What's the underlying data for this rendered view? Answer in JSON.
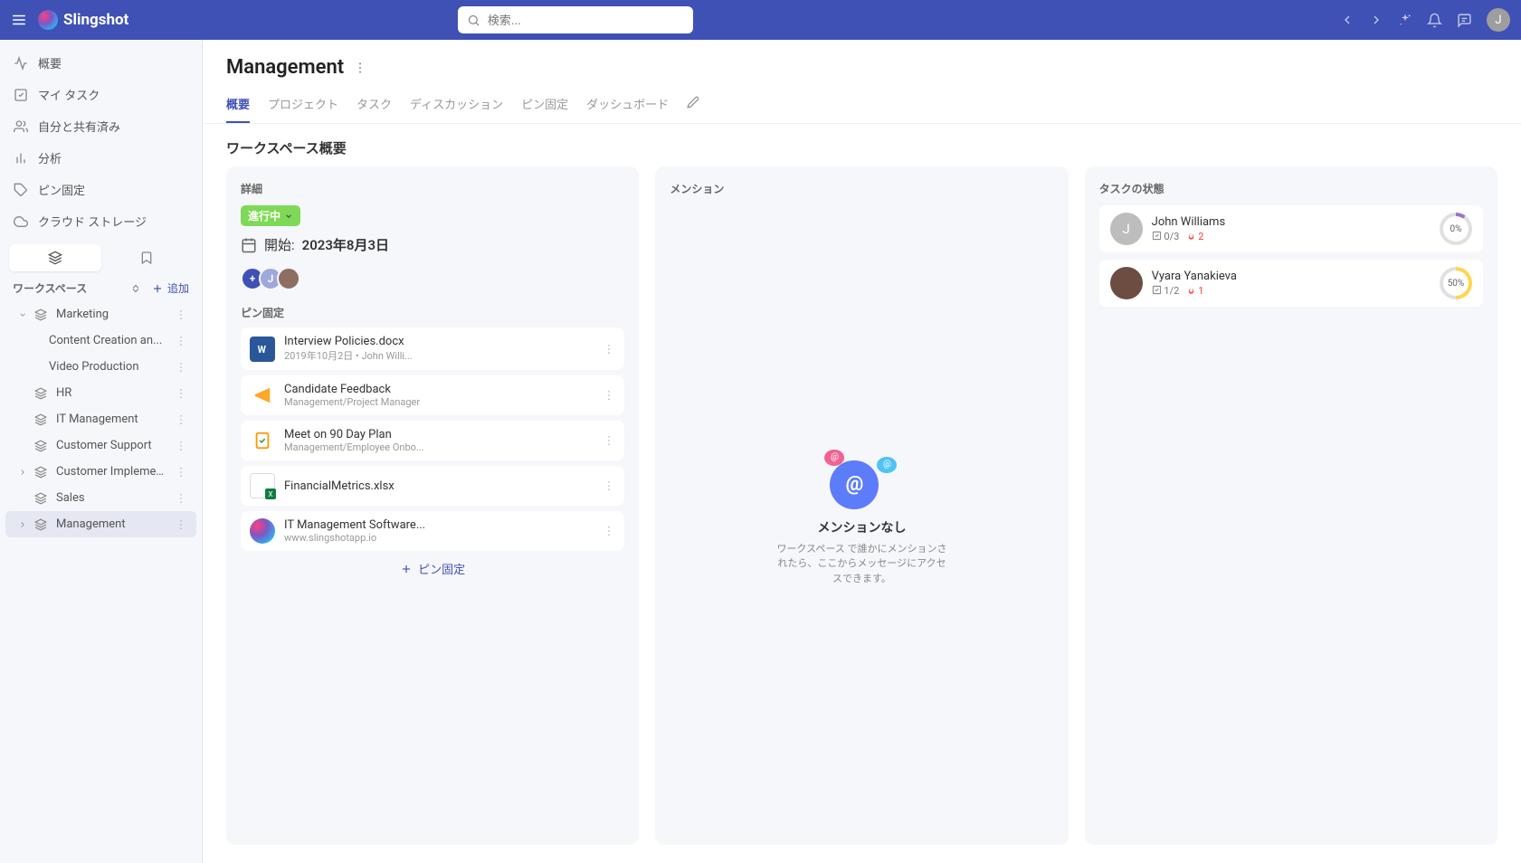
{
  "topbar": {
    "brand": "Slingshot",
    "search_placeholder": "検索...",
    "avatar_initial": "J"
  },
  "sidebar": {
    "nav": [
      {
        "label": "概要",
        "icon": "activity"
      },
      {
        "label": "マイ タスク",
        "icon": "check-square"
      },
      {
        "label": "自分と共有済み",
        "icon": "users"
      },
      {
        "label": "分析",
        "icon": "bar-chart"
      },
      {
        "label": "ピン固定",
        "icon": "tag"
      },
      {
        "label": "クラウド ストレージ",
        "icon": "cloud"
      }
    ],
    "section_label": "ワークスペース",
    "add_label": "追加",
    "workspaces": [
      {
        "label": "Marketing",
        "expanded": true,
        "children": [
          {
            "label": "Content Creation an..."
          },
          {
            "label": "Video Production"
          }
        ]
      },
      {
        "label": "HR"
      },
      {
        "label": "IT Management"
      },
      {
        "label": "Customer Support"
      },
      {
        "label": "Customer Implementa...",
        "caret": true
      },
      {
        "label": "Sales"
      },
      {
        "label": "Management",
        "selected": true,
        "caret": true
      }
    ]
  },
  "page": {
    "title": "Management",
    "tabs": [
      {
        "label": "概要",
        "active": true
      },
      {
        "label": "プロジェクト"
      },
      {
        "label": "タスク"
      },
      {
        "label": "ディスカッション"
      },
      {
        "label": "ピン固定"
      },
      {
        "label": "ダッシュボード"
      }
    ],
    "section_title": "ワークスペース概要"
  },
  "detail": {
    "card_title": "詳細",
    "status_label": "進行中",
    "start_label": "開始:",
    "start_date": "2023年8月3日",
    "avatar_plus": "+",
    "avatar_j": "J",
    "pinned_label": "ピン固定",
    "pinned_items": [
      {
        "name": "Interview Policies.docx",
        "sub": "2019年10月2日  •  John Willi...",
        "type": "word"
      },
      {
        "name": "Candidate Feedback",
        "sub": "Management/Project Manager",
        "type": "chat"
      },
      {
        "name": "Meet on 90 Day Plan",
        "sub": "Management/Employee Onbo...",
        "type": "task"
      },
      {
        "name": "FinancialMetrics.xlsx",
        "sub": "",
        "type": "excel"
      },
      {
        "name": "IT Management Software...",
        "sub": "www.slingshotapp.io",
        "type": "app"
      }
    ],
    "add_pin_label": "ピン固定"
  },
  "mentions": {
    "card_title": "メンション",
    "empty_title": "メンションなし",
    "empty_sub": "ワークスペース で誰かにメンションされたら、ここからメッセージにアクセスできます。"
  },
  "tasks": {
    "card_title": "タスクの状態",
    "users": [
      {
        "name": "John Williams",
        "initial": "J",
        "done": "0/3",
        "fire": "2",
        "pct": "0%",
        "ring": "zero"
      },
      {
        "name": "Vyara Yanakieva",
        "initial": "",
        "done": "1/2",
        "fire": "1",
        "pct": "50%",
        "ring": "fifty"
      }
    ]
  }
}
